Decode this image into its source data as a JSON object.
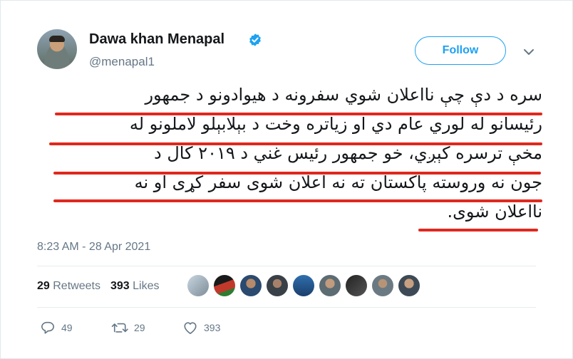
{
  "author": {
    "name": "Dawa khan Menapal",
    "handle": "@menapal1"
  },
  "header": {
    "follow_label": "Follow"
  },
  "tweet": {
    "lines": [
      "سره د دې چې نااعلان شوي سفرونه د هیوادونو د جمهور",
      "رئیسانو له لوري عام دي او زیاتره وخت د بېلابېلو لاملونو له",
      "مخې ترسره کېږي، خو جمهور رئیس غني د ۲۰۱۹ کال د",
      "جون نه وروسته پاکستان ته نه اعلان شوی سفر کړی او نه",
      "نااعلان شوی."
    ],
    "timestamp": "8:23 AM - 28 Apr 2021"
  },
  "stats": {
    "retweets_count": "29",
    "retweets_label": "Retweets",
    "likes_count": "393",
    "likes_label": "Likes"
  },
  "actions": {
    "reply_count": "49",
    "retweet_count": "29",
    "like_count": "393"
  },
  "colors": {
    "accent": "#1da1f2",
    "underline": "#e0281e",
    "muted": "#657786"
  },
  "icons": [
    "verified-badge-icon",
    "chevron-down-icon",
    "reply-icon",
    "retweet-icon",
    "heart-icon"
  ]
}
